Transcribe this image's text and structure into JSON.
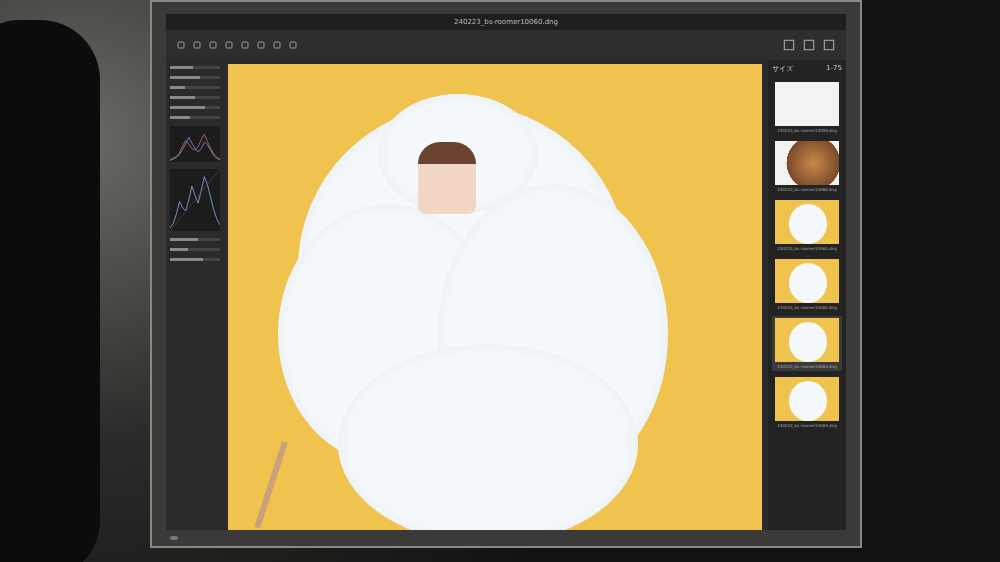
{
  "window": {
    "title": "240223_bs-roomer10060.dng"
  },
  "left_panel": {
    "sliders": [
      {
        "level": 0.45
      },
      {
        "level": 0.6
      },
      {
        "level": 0.3
      },
      {
        "level": 0.5
      },
      {
        "level": 0.7
      },
      {
        "level": 0.4
      }
    ],
    "histogram": {
      "red": [
        5,
        8,
        12,
        20,
        35,
        48,
        40,
        30,
        26,
        34,
        50,
        62,
        45,
        30,
        18,
        10,
        6
      ],
      "blue": [
        3,
        6,
        10,
        16,
        28,
        40,
        55,
        42,
        30,
        22,
        30,
        44,
        38,
        26,
        14,
        8,
        4
      ]
    },
    "curve": {
      "values": [
        4,
        10,
        22,
        38,
        30,
        26,
        40,
        58,
        46,
        36,
        52,
        70,
        60,
        44,
        28,
        16,
        8
      ]
    },
    "lower_sliders": [
      {
        "level": 0.55
      },
      {
        "level": 0.35
      },
      {
        "level": 0.65
      }
    ]
  },
  "filmstrip": {
    "label": "サイズ",
    "count": "1-75",
    "items": [
      {
        "name": "240223_bs-roomer10059.dng",
        "kind": "white",
        "selected": false
      },
      {
        "name": "240223_bs-roomer10060.dng",
        "kind": "hair",
        "selected": false
      },
      {
        "name": "240223_bs-roomer10061.dng",
        "kind": "cloud",
        "selected": false
      },
      {
        "name": "240223_bs-roomer10062.dng",
        "kind": "cloud",
        "selected": false
      },
      {
        "name": "240223_bs-roomer10063.dng",
        "kind": "cloud",
        "selected": true
      },
      {
        "name": "240223_bs-roomer10064.dng",
        "kind": "cloud",
        "selected": false
      }
    ]
  }
}
